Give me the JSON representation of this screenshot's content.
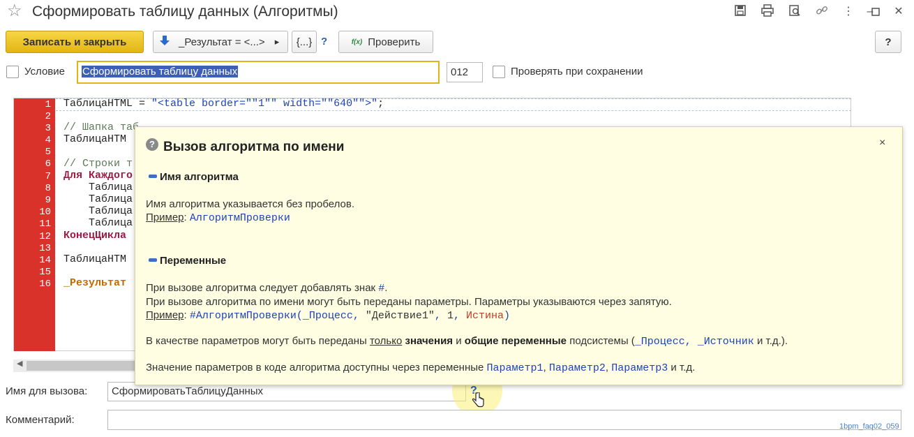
{
  "window": {
    "title": "Сформировать таблицу данных (Алгоритмы)",
    "icons": [
      "save-icon",
      "print-icon",
      "preview-icon",
      "link-icon",
      "more-icon",
      "minimize-icon",
      "maximize-icon",
      "close-icon"
    ]
  },
  "toolbar": {
    "save_close_label": "Записать и закрыть",
    "result_label": "_Результат = <...>",
    "braces_label": "{...}",
    "help_mark": "?",
    "check_label": "Проверить",
    "check_icon_text": "f(x)",
    "help_button_label": "?"
  },
  "form": {
    "condition_label": "Условие",
    "name_value": "Сформировать таблицу данных",
    "code_value": "012",
    "check_on_save_label": "Проверять при сохранении",
    "call_name_label": "Имя для вызова:",
    "call_name_value": "СформироватьТаблицуДанных",
    "call_help_mark": "?",
    "comment_label": "Комментарий:",
    "comment_value": ""
  },
  "editor": {
    "line_numbers": [
      "1",
      "2",
      "3",
      "4",
      "5",
      "6",
      "7",
      "8",
      "9",
      "10",
      "11",
      "12",
      "13",
      "14",
      "15",
      "16"
    ],
    "lines": {
      "l1_a": "ТаблицаHTML = ",
      "l1_b": "\"<table border=\"\"1\"\" width=\"\"640\"\">\"",
      "l1_c": ";",
      "l3": "// Шапка таб",
      "l4": "ТаблицаHTM",
      "l6": "// Строки т",
      "l7": "Для Каждого",
      "l8": "    Таблица",
      "l9": "    Таблица",
      "l10": "    Таблица",
      "l11": "    Таблица",
      "l12": "КонецЦикла",
      "l14": "ТаблицаHTM",
      "l16": "_Результат"
    }
  },
  "popup": {
    "title": "Вызов алгоритма по имени",
    "close_glyph": "×",
    "section1_title": "Имя алгоритма",
    "s1_text": "Имя алгоритма указывается без пробелов.",
    "example_label": "Пример",
    "colon": ":",
    "s1_example": "АлгоритмПроверки",
    "section2_title": "Переменные",
    "s2_line1": "При вызове алгоритма следует добавлять знак ",
    "s2_hash": "#",
    "s2_dot": ".",
    "s2_line2": "При вызове алгоритма по имени могут быть переданы параметры. Параметры указываются через запятую.",
    "s2_ex_call": "#АлгоритмПроверки(_Процесс, ",
    "s2_ex_str": "\"Действие1\"",
    "s2_ex_sep1": ", ",
    "s2_ex_num": "1",
    "s2_ex_sep2": ", ",
    "s2_ex_bool": "Истина",
    "s2_ex_close": ")",
    "s2_p3_a": "В качестве параметров могут быть переданы ",
    "s2_p3_only": "только",
    "s2_p3_sp1": " ",
    "s2_p3_values": "значения",
    "s2_p3_and": " и ",
    "s2_p3_common": "общие переменные",
    "s2_p3_b": " подсистемы (",
    "s2_p3_proc": "_Процесс",
    "s2_p3_comma": ", ",
    "s2_p3_src": "_Источник",
    "s2_p3_end": " и т.д.).",
    "s2_p4_a": "Значение параметров в коде алгоритма доступны через переменные ",
    "s2_p4_v1": "Параметр1",
    "s2_p4_c1": ", ",
    "s2_p4_v2": "Параметр2",
    "s2_p4_c2": ", ",
    "s2_p4_v3": "Параметр3",
    "s2_p4_end": " и т.д."
  },
  "watermark": "1bpm_faq02_059"
}
